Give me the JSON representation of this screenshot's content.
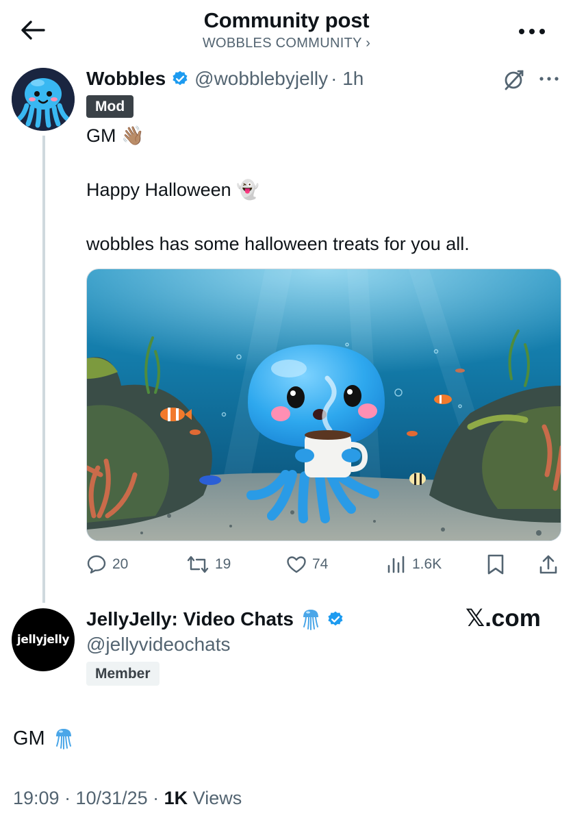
{
  "header": {
    "title": "Community post",
    "community_link": "WOBBLES COMMUNITY ›",
    "back_icon": "arrow-left-icon",
    "more_icon": "ellipsis-icon"
  },
  "post": {
    "author_name": "Wobbles",
    "author_handle": "@wobblebyjelly",
    "time": "· 1h",
    "role_badge": "Mod",
    "lines": [
      "GM 👋🏽",
      "Happy Halloween 👻",
      "wobbles has some halloween treats for you all."
    ],
    "media_icon": "jellyfish-mug-illustration",
    "actions": {
      "replies": "20",
      "reposts": "19",
      "likes": "74",
      "views": "1.6K"
    }
  },
  "reply": {
    "author_name": "JellyJelly: Video Chats",
    "author_handle": "@jellyvideochats",
    "role_badge": "Member",
    "avatar_text": "jellyjelly",
    "watermark": "𝕏.com",
    "text": "GM",
    "time": "19:09 · 10/31/25 · ",
    "views_count": "1K",
    "views_label": " Views"
  },
  "colors": {
    "text": "#0f1419",
    "secondary": "#536471",
    "verified": "#1d9bf0",
    "mod_badge_bg": "#3a4147",
    "member_badge_bg": "#eff3f4"
  }
}
